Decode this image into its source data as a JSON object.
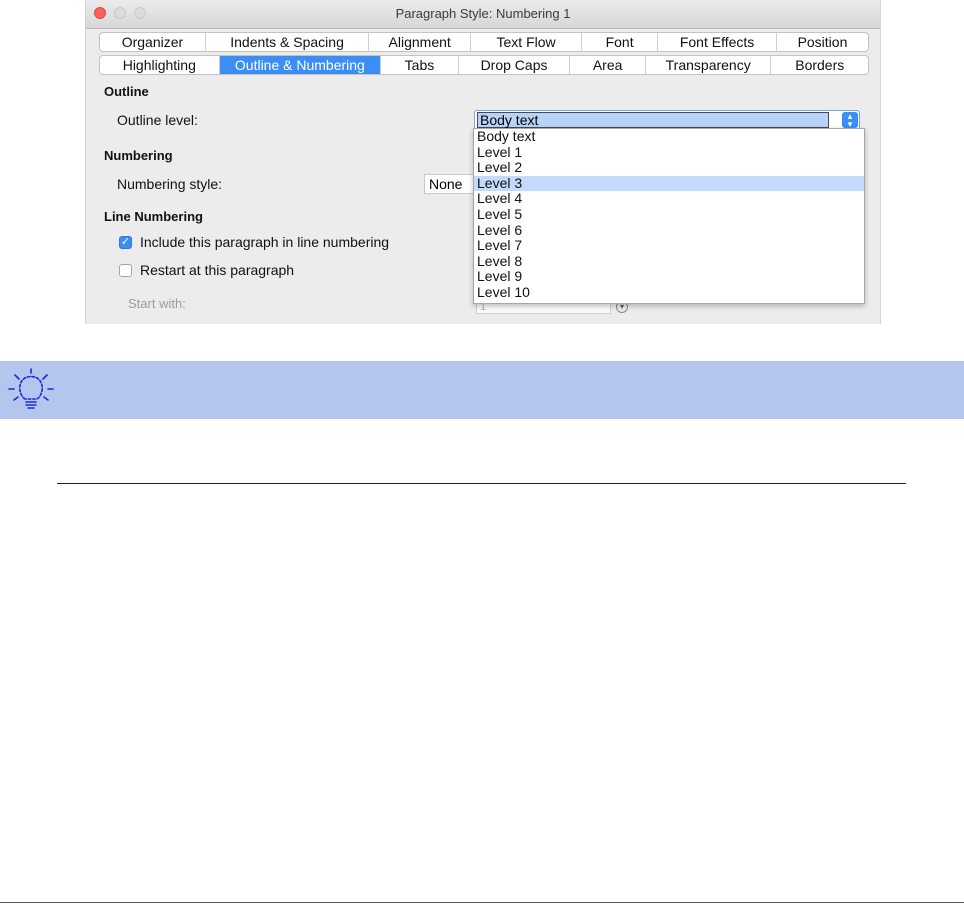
{
  "window": {
    "title": "Paragraph Style: Numbering 1"
  },
  "tabs": {
    "row1": [
      "Organizer",
      "Indents & Spacing",
      "Alignment",
      "Text Flow",
      "Font",
      "Font Effects",
      "Position"
    ],
    "row2": [
      "Highlighting",
      "Outline & Numbering",
      "Tabs",
      "Drop Caps",
      "Area",
      "Transparency",
      "Borders"
    ],
    "active": "Outline & Numbering"
  },
  "outline": {
    "heading": "Outline",
    "level_label": "Outline level:",
    "level_value": "Body text"
  },
  "numbering": {
    "heading": "Numbering",
    "style_label": "Numbering style:",
    "style_value": "None"
  },
  "line_numbering": {
    "heading": "Line Numbering",
    "include_label": "Include this paragraph in line numbering",
    "include_checked": true,
    "restart_label": "Restart at this paragraph",
    "restart_checked": false,
    "start_with_label": "Start with:",
    "start_with_value": "1"
  },
  "dropdown": {
    "options": [
      "Body text",
      "Level 1",
      "Level 2",
      "Level 3",
      "Level 4",
      "Level 5",
      "Level 6",
      "Level 7",
      "Level 8",
      "Level 9",
      "Level 10"
    ],
    "highlighted": "Level 3"
  },
  "tip": {
    "icon": "lightbulb-icon"
  },
  "colors": {
    "accent": "#3b8ef3",
    "tip_background": "#b4c6ee",
    "icon": "#1a2ad6"
  }
}
